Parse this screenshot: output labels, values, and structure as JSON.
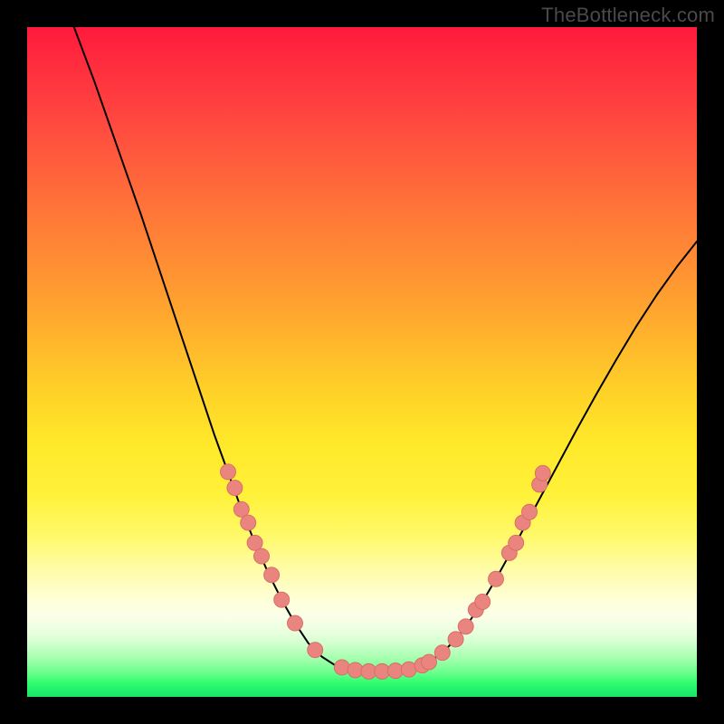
{
  "watermark": "TheBottleneck.com",
  "colors": {
    "curve": "#000000",
    "dot_fill": "#e9847e",
    "dot_stroke": "#d86a64"
  },
  "chart_data": {
    "type": "line",
    "title": "",
    "xlabel": "",
    "ylabel": "",
    "xlim": [
      0,
      100
    ],
    "ylim": [
      0,
      100
    ],
    "grid": false,
    "legend": false,
    "left_curve": {
      "name": "left",
      "comment": "Normalized points (x%, y%) top-left origin; descends from top-left into the trough",
      "points": [
        [
          7.0,
          0.0
        ],
        [
          10.0,
          8.0
        ],
        [
          13.5,
          18.0
        ],
        [
          17.0,
          28.0
        ],
        [
          20.0,
          37.0
        ],
        [
          23.0,
          46.0
        ],
        [
          26.0,
          55.0
        ],
        [
          28.0,
          61.0
        ],
        [
          30.0,
          66.5
        ],
        [
          32.0,
          72.0
        ],
        [
          34.0,
          77.0
        ],
        [
          36.0,
          81.5
        ],
        [
          38.0,
          85.5
        ],
        [
          40.0,
          89.0
        ],
        [
          42.0,
          92.0
        ],
        [
          44.0,
          94.0
        ],
        [
          46.0,
          95.3
        ],
        [
          48.0,
          95.8
        ]
      ]
    },
    "trough": {
      "name": "trough",
      "points": [
        [
          48.0,
          95.8
        ],
        [
          50.0,
          96.1
        ],
        [
          52.0,
          96.2
        ],
        [
          54.0,
          96.2
        ],
        [
          56.0,
          96.0
        ],
        [
          58.0,
          95.6
        ],
        [
          60.0,
          94.8
        ]
      ]
    },
    "right_curve": {
      "name": "right",
      "comment": "ascends from trough toward upper-right, shallower than left branch",
      "points": [
        [
          60.0,
          94.8
        ],
        [
          62.0,
          93.4
        ],
        [
          64.0,
          91.4
        ],
        [
          66.0,
          88.8
        ],
        [
          68.0,
          85.8
        ],
        [
          70.0,
          82.4
        ],
        [
          73.0,
          77.0
        ],
        [
          76.0,
          71.4
        ],
        [
          79.0,
          65.8
        ],
        [
          82.0,
          60.2
        ],
        [
          85.0,
          54.8
        ],
        [
          88.0,
          49.6
        ],
        [
          91.0,
          44.6
        ],
        [
          94.0,
          40.0
        ],
        [
          97.0,
          35.8
        ],
        [
          100.0,
          32.0
        ]
      ]
    },
    "dots_left": {
      "name": "left-dots",
      "comment": "salmon markers along lower part of left branch; (x%, y%)",
      "points": [
        [
          30.0,
          66.4
        ],
        [
          31.0,
          68.8
        ],
        [
          32.0,
          72.0
        ],
        [
          33.0,
          74.0
        ],
        [
          34.0,
          77.0
        ],
        [
          35.0,
          79.0
        ],
        [
          36.5,
          81.8
        ],
        [
          38.0,
          85.5
        ],
        [
          40.0,
          89.0
        ],
        [
          43.0,
          93.0
        ]
      ]
    },
    "dots_right": {
      "name": "right-dots",
      "points": [
        [
          60.0,
          94.8
        ],
        [
          62.0,
          93.4
        ],
        [
          64.0,
          91.4
        ],
        [
          65.5,
          89.5
        ],
        [
          67.0,
          87.0
        ],
        [
          68.0,
          85.8
        ],
        [
          70.0,
          82.4
        ],
        [
          72.0,
          78.5
        ],
        [
          73.0,
          77.0
        ],
        [
          74.0,
          74.0
        ],
        [
          75.0,
          72.4
        ],
        [
          76.5,
          68.3
        ],
        [
          77.0,
          66.6
        ]
      ]
    },
    "dots_trough": {
      "name": "trough-dots",
      "points": [
        [
          47.0,
          95.6
        ],
        [
          49.0,
          96.0
        ],
        [
          51.0,
          96.2
        ],
        [
          53.0,
          96.2
        ],
        [
          55.0,
          96.1
        ],
        [
          57.0,
          95.9
        ],
        [
          59.0,
          95.3
        ]
      ]
    },
    "dot_radius_pct": 1.15
  }
}
